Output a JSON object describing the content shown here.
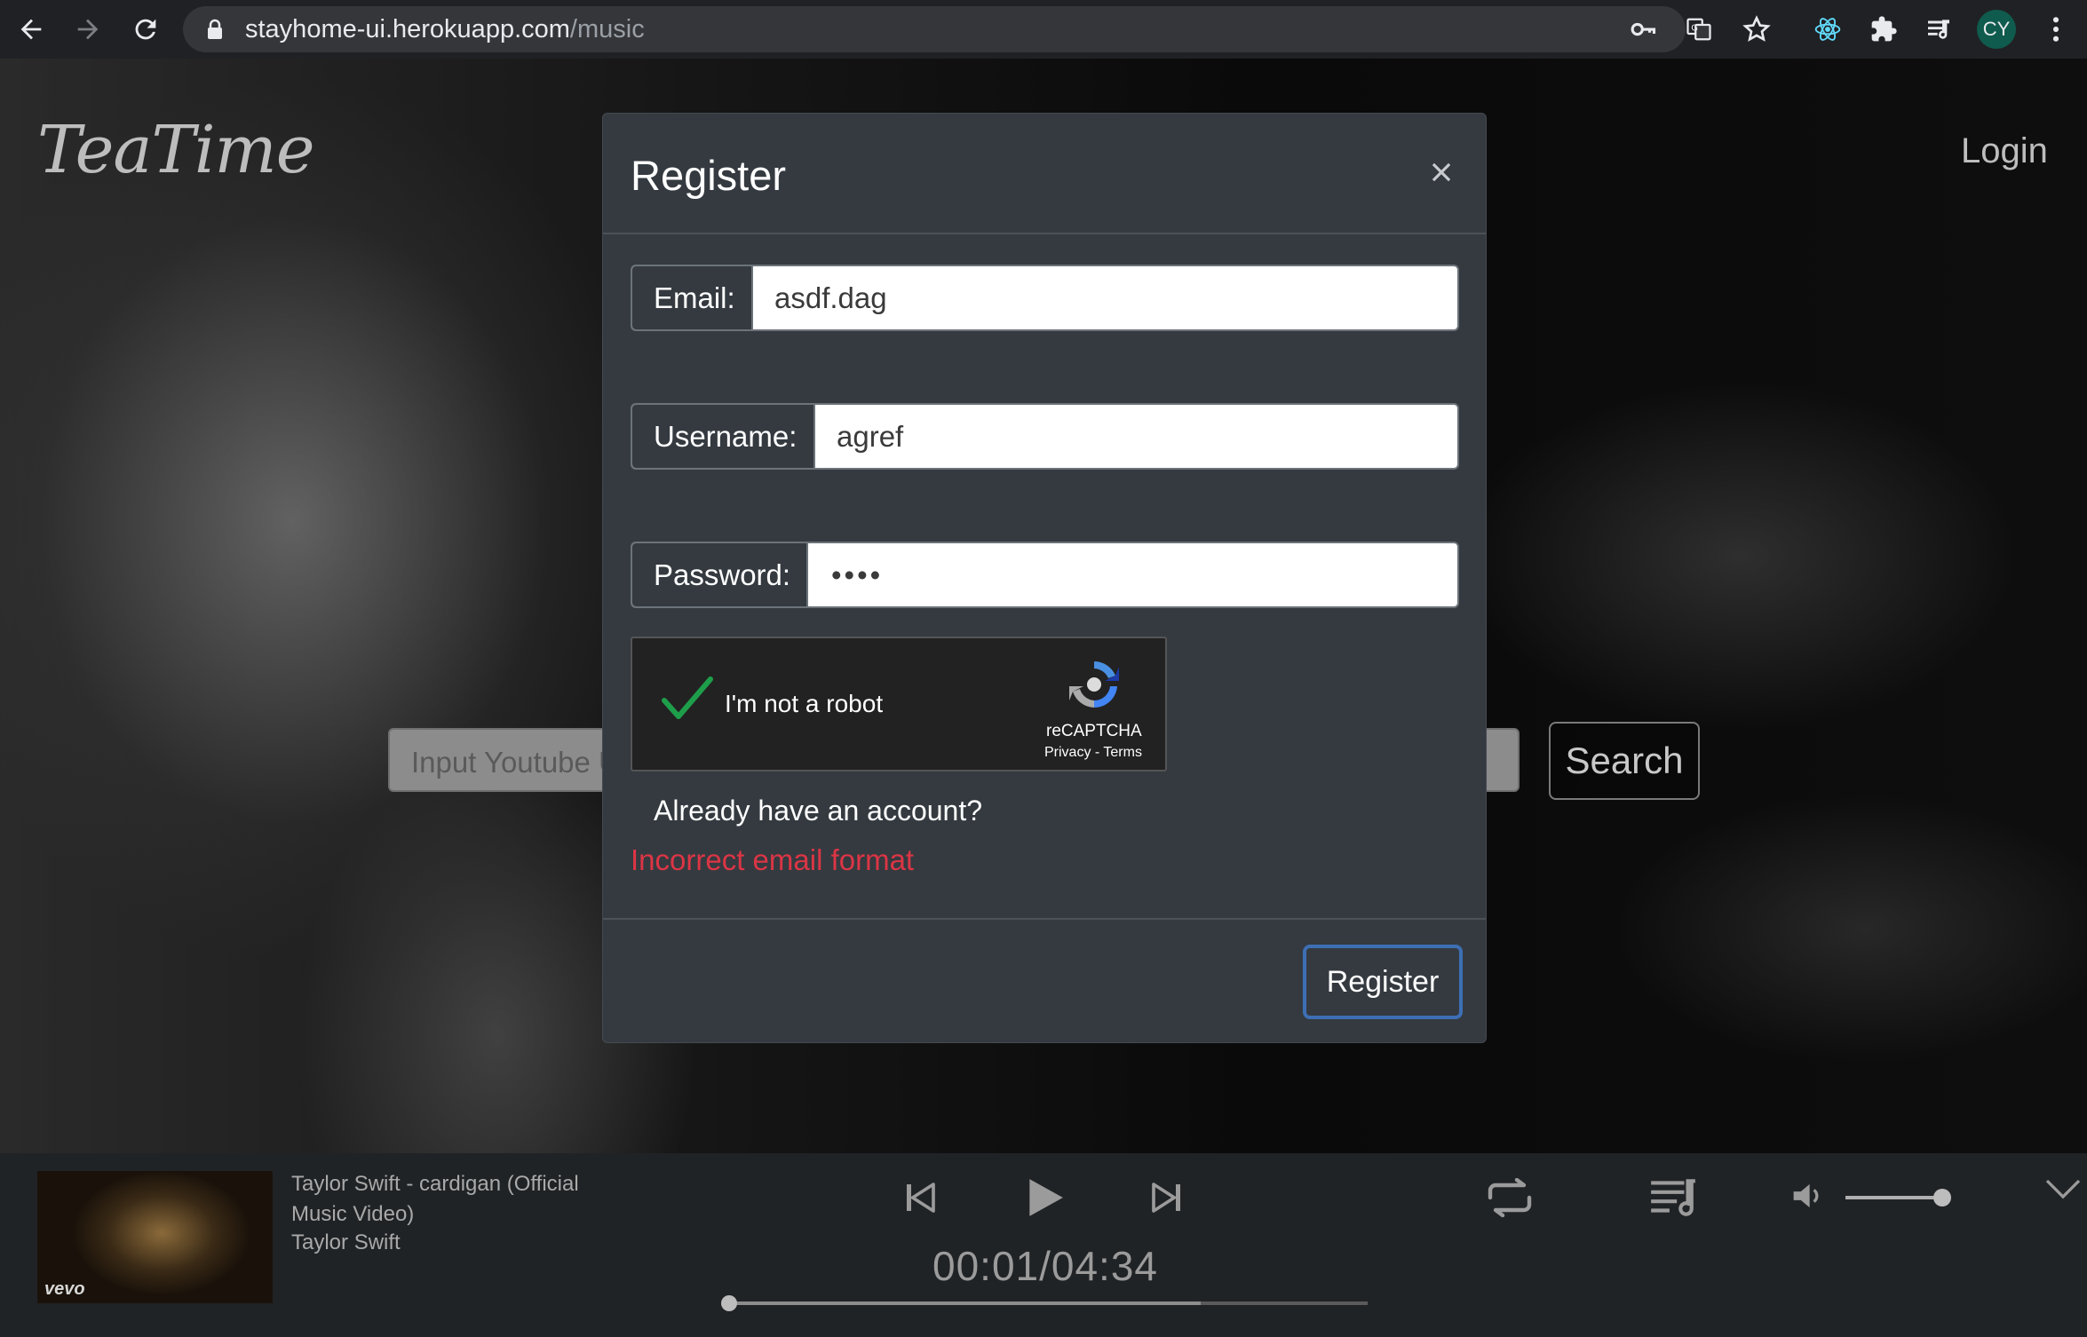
{
  "browser": {
    "url_host": "stayhome-ui.herokuapp.com",
    "url_path": "/music",
    "profile_initials": "CY"
  },
  "site": {
    "logo": "TeaTime",
    "login_label": "Login",
    "search_placeholder": "Input Youtube U",
    "search_label": "Search"
  },
  "modal": {
    "title": "Register",
    "email_label": "Email:",
    "email_value": "asdf.dag",
    "username_label": "Username:",
    "username_value": "agref",
    "password_label": "Password:",
    "password_value": "••••",
    "captcha_text": "I'm not a robot",
    "captcha_brand": "reCAPTCHA",
    "captcha_links": "Privacy - Terms",
    "already_account": "Already have an account?",
    "error_message": "Incorrect email format",
    "register_button": "Register"
  },
  "player": {
    "song_title": "Taylor Swift - cardigan (Official Music Video)",
    "artist": "Taylor Swift",
    "thumb_badge": "vevo",
    "time_display": "00:01/04:34",
    "progress_fraction": 0.0037,
    "buffered_fraction": 0.74,
    "volume_fraction": 0.9
  },
  "colors": {
    "error": "#dc3545",
    "focus_border": "#3d6fb4",
    "modal_bg": "#343a40",
    "captcha_check": "#1e9e4a"
  },
  "icons": [
    "back-icon",
    "forward-icon",
    "reload-icon",
    "lock-icon",
    "key-icon",
    "translate-icon",
    "star-icon",
    "react-icon",
    "puzzle-icon",
    "queue-icon",
    "menu-dots-icon",
    "close-icon",
    "checkmark-icon",
    "recaptcha-logo-icon",
    "previous-track-icon",
    "play-icon",
    "next-track-icon",
    "repeat-icon",
    "playlist-icon",
    "volume-icon",
    "chevron-down-icon"
  ]
}
